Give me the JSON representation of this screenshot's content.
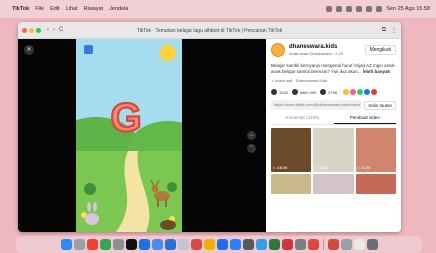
{
  "menubar": {
    "items": [
      "TikTok",
      "File",
      "Edit",
      "Lihat",
      "Riwayat",
      "Jendela"
    ],
    "datetime": "Sen 25 Agu 15.58"
  },
  "window": {
    "title": "TikTok · Temukan belajar lagu alfabet di TikTok | Pencarian TikTok"
  },
  "nav": {
    "back": "‹",
    "forward": "›",
    "reload": "C"
  },
  "video": {
    "letter": "G",
    "close": "✕",
    "up": "︿",
    "down": "﹀"
  },
  "panel": {
    "username": "dhaneswara.kids",
    "subname": "Anak-anak Dhaneswara · 2-29",
    "follow_label": "Mengikuti",
    "description": "Belajar sambil bernyanyi mengenal huruf Abjad AZ Ingin anak-anak belajar sambil bermain? Yuk ikut akun...",
    "more": "lebih banyak",
    "sound": "♫ suara asli · Dhaneswara Kids",
    "likes": "1043",
    "comments": "lebih 993",
    "saves": "3796",
    "link": "https://www.tiktok.com/@dhaneswara.kids/video/74...",
    "copy_label": "Salin tautan",
    "tabs": [
      "Komentar (1100)",
      "Pembuat video"
    ],
    "thumbs": [
      {
        "views": "▷ 108.5K",
        "color": "#6b4a2a"
      },
      {
        "views": "▷ 48.6K",
        "color": "#d9d4c8"
      },
      {
        "views": "▷ 41.5K",
        "color": "#d1856e"
      },
      {
        "views": "",
        "color": "#c9b88a"
      },
      {
        "views": "",
        "color": "#d6c3c7"
      },
      {
        "views": "",
        "color": "#c76a55"
      }
    ]
  },
  "dock": {
    "colors": [
      "#2a8df4",
      "#9aa0a6",
      "#ea4335",
      "#34a853",
      "#8e8e93",
      "#111111",
      "#1a73e8",
      "#4b8bf5",
      "#2f6fd1",
      "#c0c7d0",
      "#d94a45",
      "#f0b000",
      "#1f6feb",
      "#2d7ff9",
      "#555a62",
      "#2f9ee6",
      "#2b7a3d",
      "#c9393b",
      "#7a7f86",
      "#e04646",
      "#d14a3c",
      "#9a9ea5",
      "#e8e8e8",
      "#6a6f76"
    ]
  }
}
